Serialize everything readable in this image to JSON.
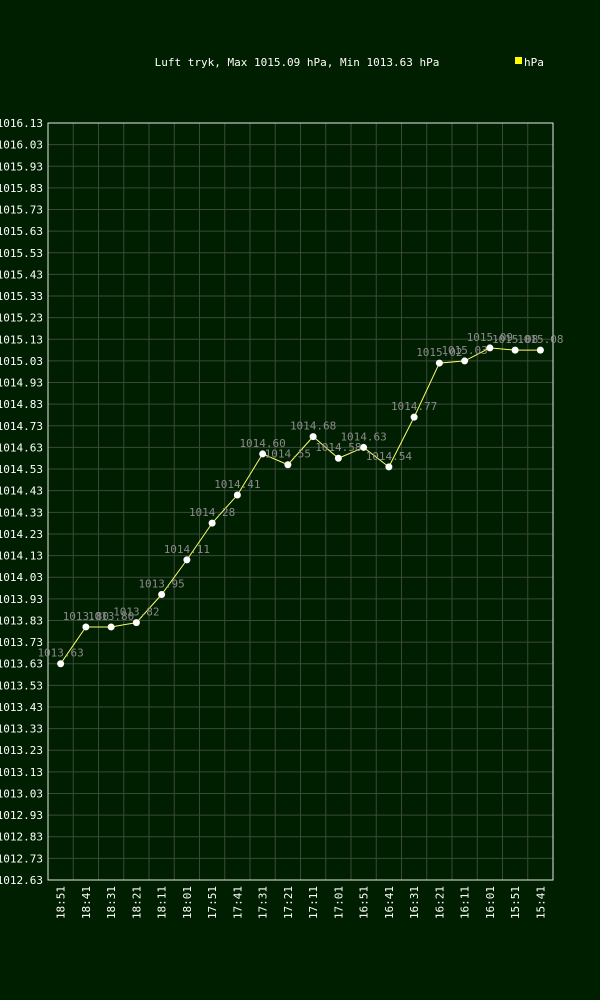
{
  "colors": {
    "background": "#001e00",
    "plot_border": "#e8e8e8",
    "grid": "#3a4a3a",
    "line": "#ffff66",
    "marker_fill": "#ffffff",
    "point_label": "#8a8a8a",
    "text": "#ffffff",
    "legend_swatch": "#ffff00"
  },
  "chart_data": {
    "type": "line",
    "title": "Luft tryk, Max 1015.09 hPa, Min 1013.63 hPa",
    "legend": [
      {
        "label": "hPa",
        "position": "top-right"
      }
    ],
    "grid": true,
    "ylim": [
      1012.63,
      1016.13
    ],
    "y_ticks": [
      "1016.13",
      "1016.03",
      "1015.93",
      "1015.83",
      "1015.73",
      "1015.63",
      "1015.53",
      "1015.43",
      "1015.33",
      "1015.23",
      "1015.13",
      "1015.03",
      "1014.93",
      "1014.83",
      "1014.73",
      "1014.63",
      "1014.53",
      "1014.43",
      "1014.33",
      "1014.23",
      "1014.13",
      "1014.03",
      "1013.93",
      "1013.83",
      "1013.73",
      "1013.63",
      "1013.53",
      "1013.43",
      "1013.33",
      "1013.23",
      "1013.13",
      "1013.03",
      "1012.93",
      "1012.83",
      "1012.73",
      "1012.63"
    ],
    "categories": [
      "18:51",
      "18:41",
      "18:31",
      "18:21",
      "18:11",
      "18:01",
      "17:51",
      "17:41",
      "17:31",
      "17:21",
      "17:11",
      "17:01",
      "16:51",
      "16:41",
      "16:31",
      "16:21",
      "16:11",
      "16:01",
      "15:51",
      "15:41"
    ],
    "series": [
      {
        "name": "hPa",
        "values": [
          1013.63,
          1013.8,
          1013.8,
          1013.82,
          1013.95,
          1014.11,
          1014.28,
          1014.41,
          1014.6,
          1014.55,
          1014.68,
          1014.58,
          1014.63,
          1014.54,
          1014.77,
          1015.02,
          1015.03,
          1015.09,
          1015.08,
          1015.08
        ],
        "labels": [
          "1013.63",
          "1013.80",
          "1013.80",
          "1013.82",
          "1013.95",
          "1014.11",
          "1014.28",
          "1014.41",
          "1014.60",
          "1014.55",
          "1014.68",
          "1014.58",
          "1014.63",
          "1014.54",
          "1014.77",
          "1015.02",
          "1015.03",
          "1015.09",
          "1015.08",
          "1015.08"
        ]
      }
    ]
  }
}
